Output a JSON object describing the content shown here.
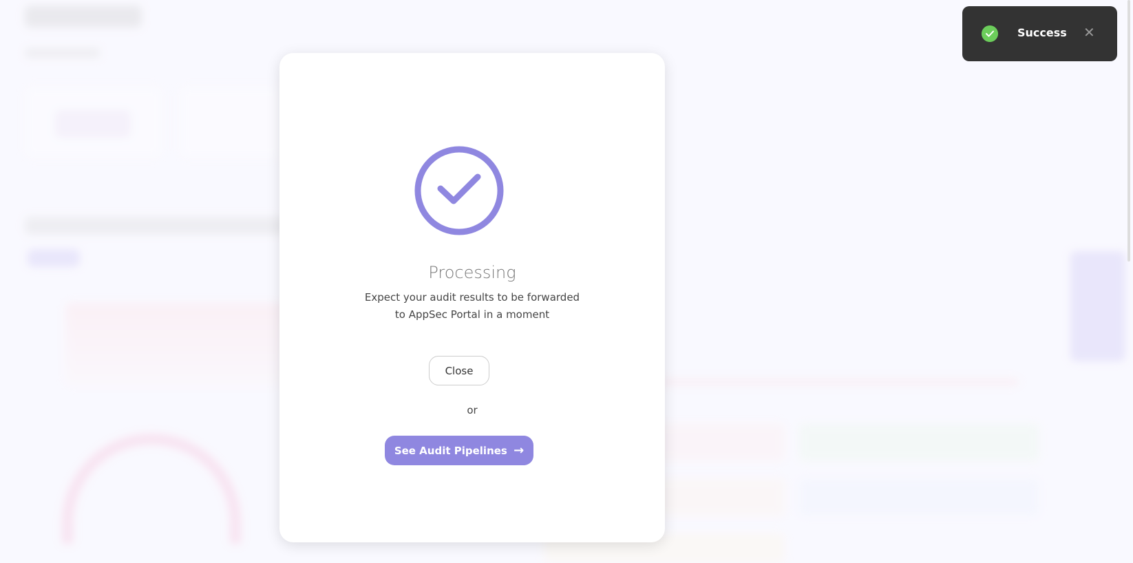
{
  "modal": {
    "title": "Processing",
    "description_line1": "Expect your audit results to be forwarded",
    "description_line2": "to AppSec Portal in a moment",
    "close_label": "Close",
    "or_label": "or",
    "primary_label": "See Audit Pipelines",
    "primary_arrow": "→",
    "accent_color": "#8f87e0"
  },
  "toast": {
    "message": "Success",
    "close_glyph": "✕",
    "icon_color": "#6ccd5b"
  }
}
